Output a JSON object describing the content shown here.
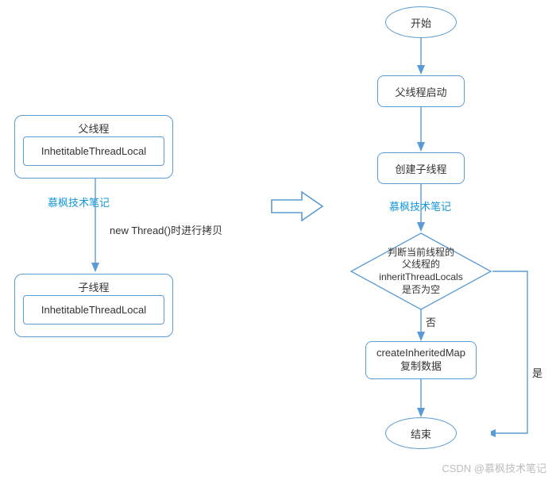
{
  "left": {
    "parent_title": "父线程",
    "parent_inner": "InhetitableThreadLocal",
    "child_title": "子线程",
    "child_inner": "InhetitableThreadLocal",
    "watermark": "慕枫技术笔记",
    "copy_label": "new Thread()时进行拷贝"
  },
  "right": {
    "start": "开始",
    "parent_start": "父线程启动",
    "create_child": "创建子线程",
    "watermark": "慕枫技术笔记",
    "decision": "判断当前线程的\n父线程的inheritThreadLocals\n是否为空",
    "no_label": "否",
    "yes_label": "是",
    "create_map": "createInheritedMap\n复制数据",
    "end": "结束"
  },
  "footer": "CSDN @慕枫技术笔记"
}
